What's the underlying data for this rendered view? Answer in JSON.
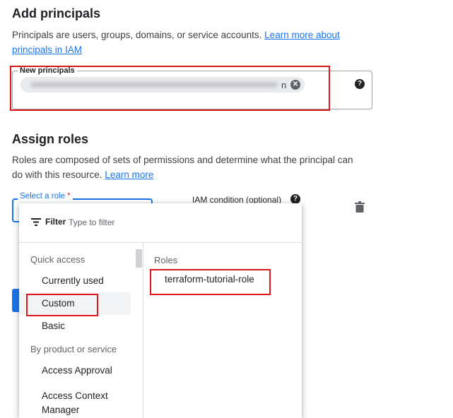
{
  "add_principals": {
    "heading": "Add principals",
    "description": "Principals are users, groups, domains, or service accounts.",
    "learn_more_link": "Learn more about principals in IAM",
    "field_label": "New principals",
    "chip_visible_suffix": "n"
  },
  "assign_roles": {
    "heading": "Assign roles",
    "description": "Roles are composed of sets of permissions and determine what the principal can do with this resource.",
    "learn_more_link": "Learn more",
    "select_role_label": "Select a role",
    "required_marker": "*",
    "condition_label": "IAM condition (optional)"
  },
  "dropdown": {
    "filter_label": "Filter",
    "filter_placeholder": "Type to filter",
    "quick_access_label": "Quick access",
    "quick_access_items": [
      "Currently used",
      "Custom",
      "Basic"
    ],
    "selected_item": "Custom",
    "by_product_label": "By product or service",
    "product_items": [
      "Access Approval",
      "Access Context Manager"
    ],
    "roles_label": "Roles",
    "roles": [
      "terraform-tutorial-role"
    ]
  },
  "icons": {
    "help": "help-icon",
    "chip_remove": "close-icon",
    "delete": "trash-icon",
    "filter": "filter-icon"
  },
  "colors": {
    "accent": "#1a73e8",
    "highlight_box": "#e0161b",
    "required": "#d93025"
  }
}
